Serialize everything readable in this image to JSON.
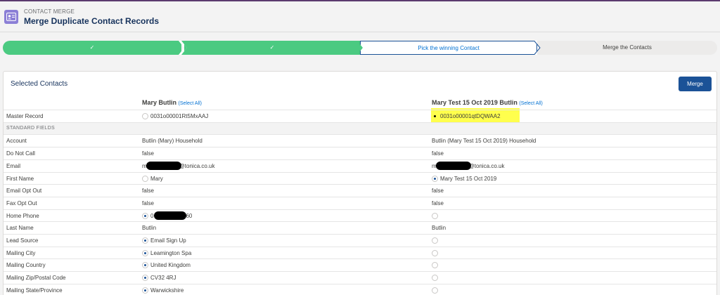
{
  "header": {
    "subtitle": "CONTACT MERGE",
    "title": "Merge Duplicate Contact Records"
  },
  "path": {
    "steps": [
      {
        "state": "done",
        "label": "✓"
      },
      {
        "state": "done",
        "label": "✓"
      },
      {
        "state": "current",
        "label": "Pick the winning Contact"
      },
      {
        "state": "todo",
        "label": "Merge the Contacts"
      }
    ]
  },
  "card": {
    "title": "Selected Contacts",
    "merge_label": "Merge",
    "columns": [
      {
        "name": "Mary Butlin",
        "select_all": "(Select All)"
      },
      {
        "name": "Mary Test 15 Oct 2019 Butlin",
        "select_all": "(Select All)"
      }
    ],
    "master_record": {
      "label": "Master Record",
      "v1": "0031o00001Rt5MxAAJ",
      "v2": "0031o00001qtDQWAA2"
    },
    "section_label": "STANDARD FIELDS",
    "fields": [
      {
        "label": "Account",
        "v1": "Butlin (Mary) Household",
        "v2": "Butlin (Mary Test 15 Oct 2019) Household"
      },
      {
        "label": "Do Not Call",
        "v1": "false",
        "v2": "false"
      },
      {
        "label": "Email",
        "v1_start": "m",
        "v1_end": "@tonica.co.uk",
        "v2_start": "m",
        "v2_end": "@tonica.co.uk"
      },
      {
        "label": "First Name",
        "v1": "Mary",
        "v2": "Mary Test 15 Oct 2019"
      },
      {
        "label": "Email Opt Out",
        "v1": "false",
        "v2": "false"
      },
      {
        "label": "Fax Opt Out",
        "v1": "false",
        "v2": "false"
      },
      {
        "label": "Home Phone",
        "v1_start": "0",
        "v1_end": "60",
        "v2": ""
      },
      {
        "label": "Last Name",
        "v1": "Butlin",
        "v2": "Butlin"
      },
      {
        "label": "Lead Source",
        "v1": "Email Sign Up",
        "v2": ""
      },
      {
        "label": "Mailing City",
        "v1": "Leamington Spa",
        "v2": ""
      },
      {
        "label": "Mailing Country",
        "v1": "United Kingdom",
        "v2": ""
      },
      {
        "label": "Mailing Zip/Postal Code",
        "v1": "CV32 4RJ",
        "v2": ""
      },
      {
        "label": "Mailing State/Province",
        "v1": "Warwickshire",
        "v2": ""
      }
    ]
  },
  "colors": {
    "done": "#4bca81",
    "current_border": "#1b5297",
    "brand": "#1b5297",
    "highlight": "#ffff4d"
  }
}
